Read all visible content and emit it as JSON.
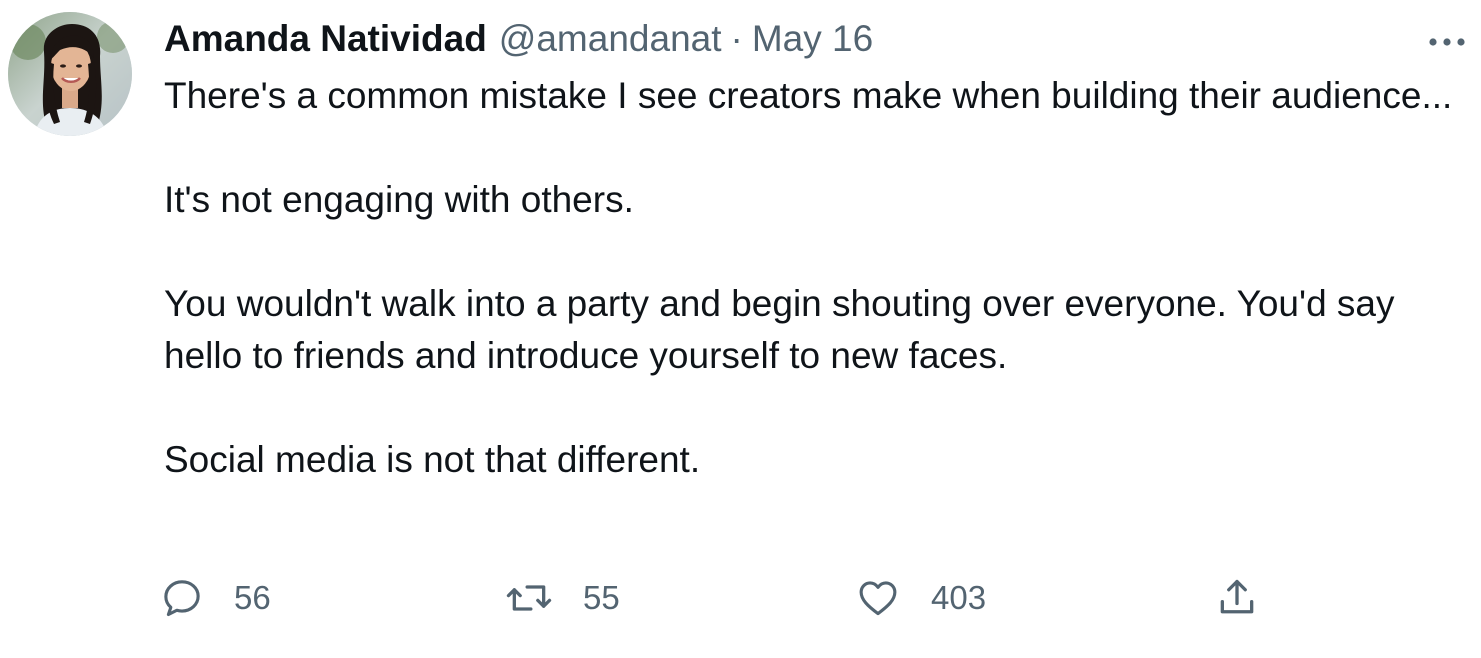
{
  "tweet": {
    "author": {
      "display_name": "Amanda Natividad",
      "handle": "@amandanat",
      "separator": "·",
      "date": "May 16",
      "avatar_icon": "profile-photo"
    },
    "paragraphs": [
      "There's a common mistake I see creators make when building their audience...",
      "It's not engaging with others.",
      "You wouldn't walk into a party and begin shouting over everyone. You'd say hello to friends and introduce yourself to new faces.",
      "Social media is not that different."
    ],
    "more_icon": "more-horizontal-icon",
    "actions": {
      "reply": {
        "icon": "reply-icon",
        "count": "56"
      },
      "retweet": {
        "icon": "retweet-icon",
        "count": "55"
      },
      "like": {
        "icon": "heart-icon",
        "count": "403"
      },
      "share": {
        "icon": "share-icon"
      }
    },
    "colors": {
      "text_primary": "#0f1419",
      "text_secondary": "#536471",
      "background": "#ffffff"
    }
  }
}
